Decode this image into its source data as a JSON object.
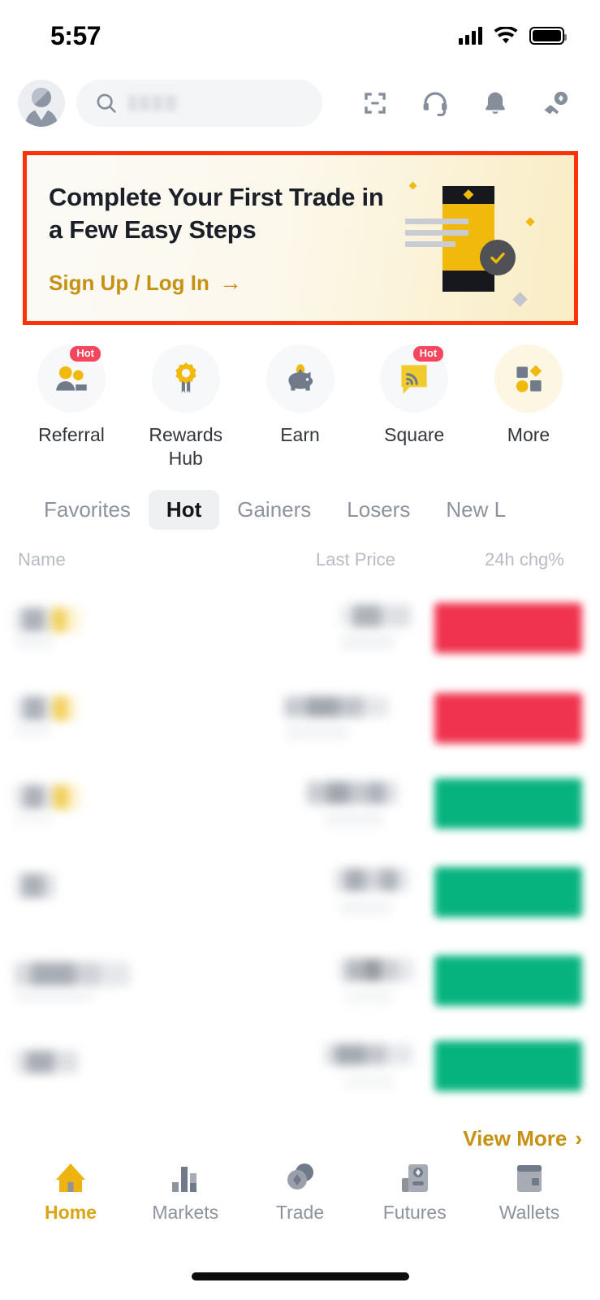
{
  "status_bar": {
    "time": "5:57",
    "icons": [
      "signal-icon",
      "wifi-icon",
      "battery-icon"
    ]
  },
  "top_bar": {
    "avatar": "user-avatar",
    "search": {
      "placeholder": "",
      "icon": "search-icon"
    },
    "actions": [
      {
        "name": "scan-icon",
        "label": "Scan"
      },
      {
        "name": "headset-icon",
        "label": "Support"
      },
      {
        "name": "bell-icon",
        "label": "Notifications"
      },
      {
        "name": "deposit-icon",
        "label": "Deposit"
      }
    ]
  },
  "banner": {
    "title": "Complete Your First Trade in a Few Easy Steps",
    "title_line1": "Complete Your First Trade in",
    "title_line2": "a Few Easy Steps",
    "cta": "Sign Up / Log In",
    "cta_arrow": "→",
    "highlight_color": "#fc3208",
    "accent_color": "#c69214",
    "illustration": "phone-checkmark-illustration"
  },
  "quick_actions": [
    {
      "label": "Referral",
      "icon": "referral-people-icon",
      "badge": "Hot",
      "circle": "gray"
    },
    {
      "label": "Rewards Hub",
      "icon": "rewards-medal-icon",
      "badge": "",
      "circle": "gray"
    },
    {
      "label": "Earn",
      "icon": "earn-piggybank-icon",
      "badge": "",
      "circle": "gray"
    },
    {
      "label": "Square",
      "icon": "square-speech-icon",
      "badge": "Hot",
      "circle": "gray"
    },
    {
      "label": "More",
      "icon": "more-shapes-icon",
      "badge": "",
      "circle": "cream"
    }
  ],
  "market_tabs": [
    {
      "label": "Favorites",
      "active": false
    },
    {
      "label": "Hot",
      "active": true
    },
    {
      "label": "Gainers",
      "active": false
    },
    {
      "label": "Losers",
      "active": false
    },
    {
      "label": "New L",
      "active": false
    }
  ],
  "market_table": {
    "columns": [
      "Name",
      "Last Price",
      "24h chg%"
    ],
    "rows": [
      {
        "name": "",
        "price": "",
        "change": "",
        "direction": "down",
        "redacted": true
      },
      {
        "name": "",
        "price": "",
        "change": "",
        "direction": "down",
        "redacted": true
      },
      {
        "name": "",
        "price": "",
        "change": "",
        "direction": "up",
        "redacted": true
      },
      {
        "name": "",
        "price": "",
        "change": "",
        "direction": "up",
        "redacted": true
      },
      {
        "name": "",
        "price": "",
        "change": "",
        "direction": "up",
        "redacted": true
      },
      {
        "name": "",
        "price": "",
        "change": "",
        "direction": "up",
        "redacted": true
      }
    ],
    "view_more": "View More",
    "view_more_arrow": "›",
    "up_color": "#06b37f",
    "down_color": "#f0334e"
  },
  "bottom_nav": [
    {
      "label": "Home",
      "icon": "home-icon",
      "active": true
    },
    {
      "label": "Markets",
      "icon": "markets-bars-icon",
      "active": false
    },
    {
      "label": "Trade",
      "icon": "trade-coins-icon",
      "active": false
    },
    {
      "label": "Futures",
      "icon": "futures-contract-icon",
      "active": false
    },
    {
      "label": "Wallets",
      "icon": "wallet-icon",
      "active": false
    }
  ]
}
